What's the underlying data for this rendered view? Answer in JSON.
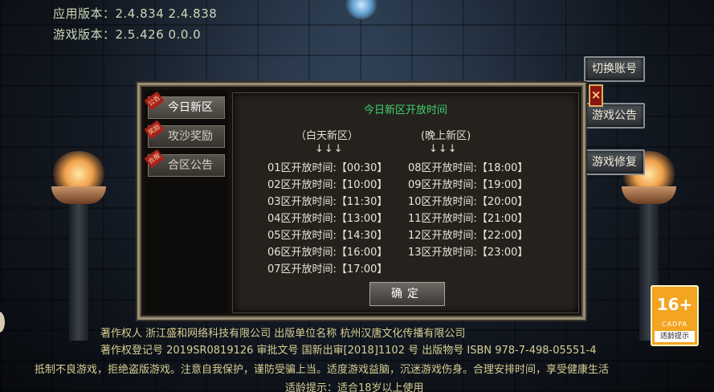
{
  "version": {
    "app_version": "应用版本：2.4.834  2.4.838",
    "game_version": "游戏版本：2.5.426  0.0.0"
  },
  "side_buttons": {
    "switch_account": "切换账号",
    "game_notice": "游戏公告",
    "game_repair": "游戏修复"
  },
  "dialog": {
    "tabs": [
      {
        "label": "今日新区",
        "flag": "公告"
      },
      {
        "label": "攻沙奖励",
        "flag": "奖励"
      },
      {
        "label": "合区公告",
        "flag": "合服"
      }
    ],
    "close_label": "×",
    "title": "今日新区开放时间",
    "day_header": "（白天新区）",
    "night_header": "(晚上新区)",
    "arrows": "↓↓↓",
    "day_rows": [
      "01区开放时间:【00:30】",
      "02区开放时间:【10:00】",
      "03区开放时间:【11:30】",
      "04区开放时间:【13:00】",
      "05区开放时间:【14:30】",
      "06区开放时间:【16:00】",
      "07区开放时间:【17:00】"
    ],
    "night_rows": [
      "08区开放时间:【18:00】",
      "09区开放时间:【19:00】",
      "10区开放时间:【20:00】",
      "11区开放时间:【21:00】",
      "12区开放时间:【22:00】",
      "13区开放时间:【23:00】"
    ],
    "confirm_label": "确定"
  },
  "footer": {
    "line1": "著作权人 浙江盛和网络科技有限公司 出版单位名称 杭州汉唐文化传播有限公司",
    "line2": "著作权登记号 2019SR0819126 审批文号 国新出审[2018]1102 号 出版物号 ISBN 978-7-498-05551-4",
    "line3": "抵制不良游戏，拒绝盗版游戏。注意自我保护，谨防受骗上当。适度游戏益脑，沉迷游戏伤身。合理安排时间，享受健康生活",
    "line4": "适龄提示：适合18岁以上使用"
  },
  "rating": {
    "age": "16+",
    "org": "CADPA",
    "hint": "适龄提示"
  }
}
